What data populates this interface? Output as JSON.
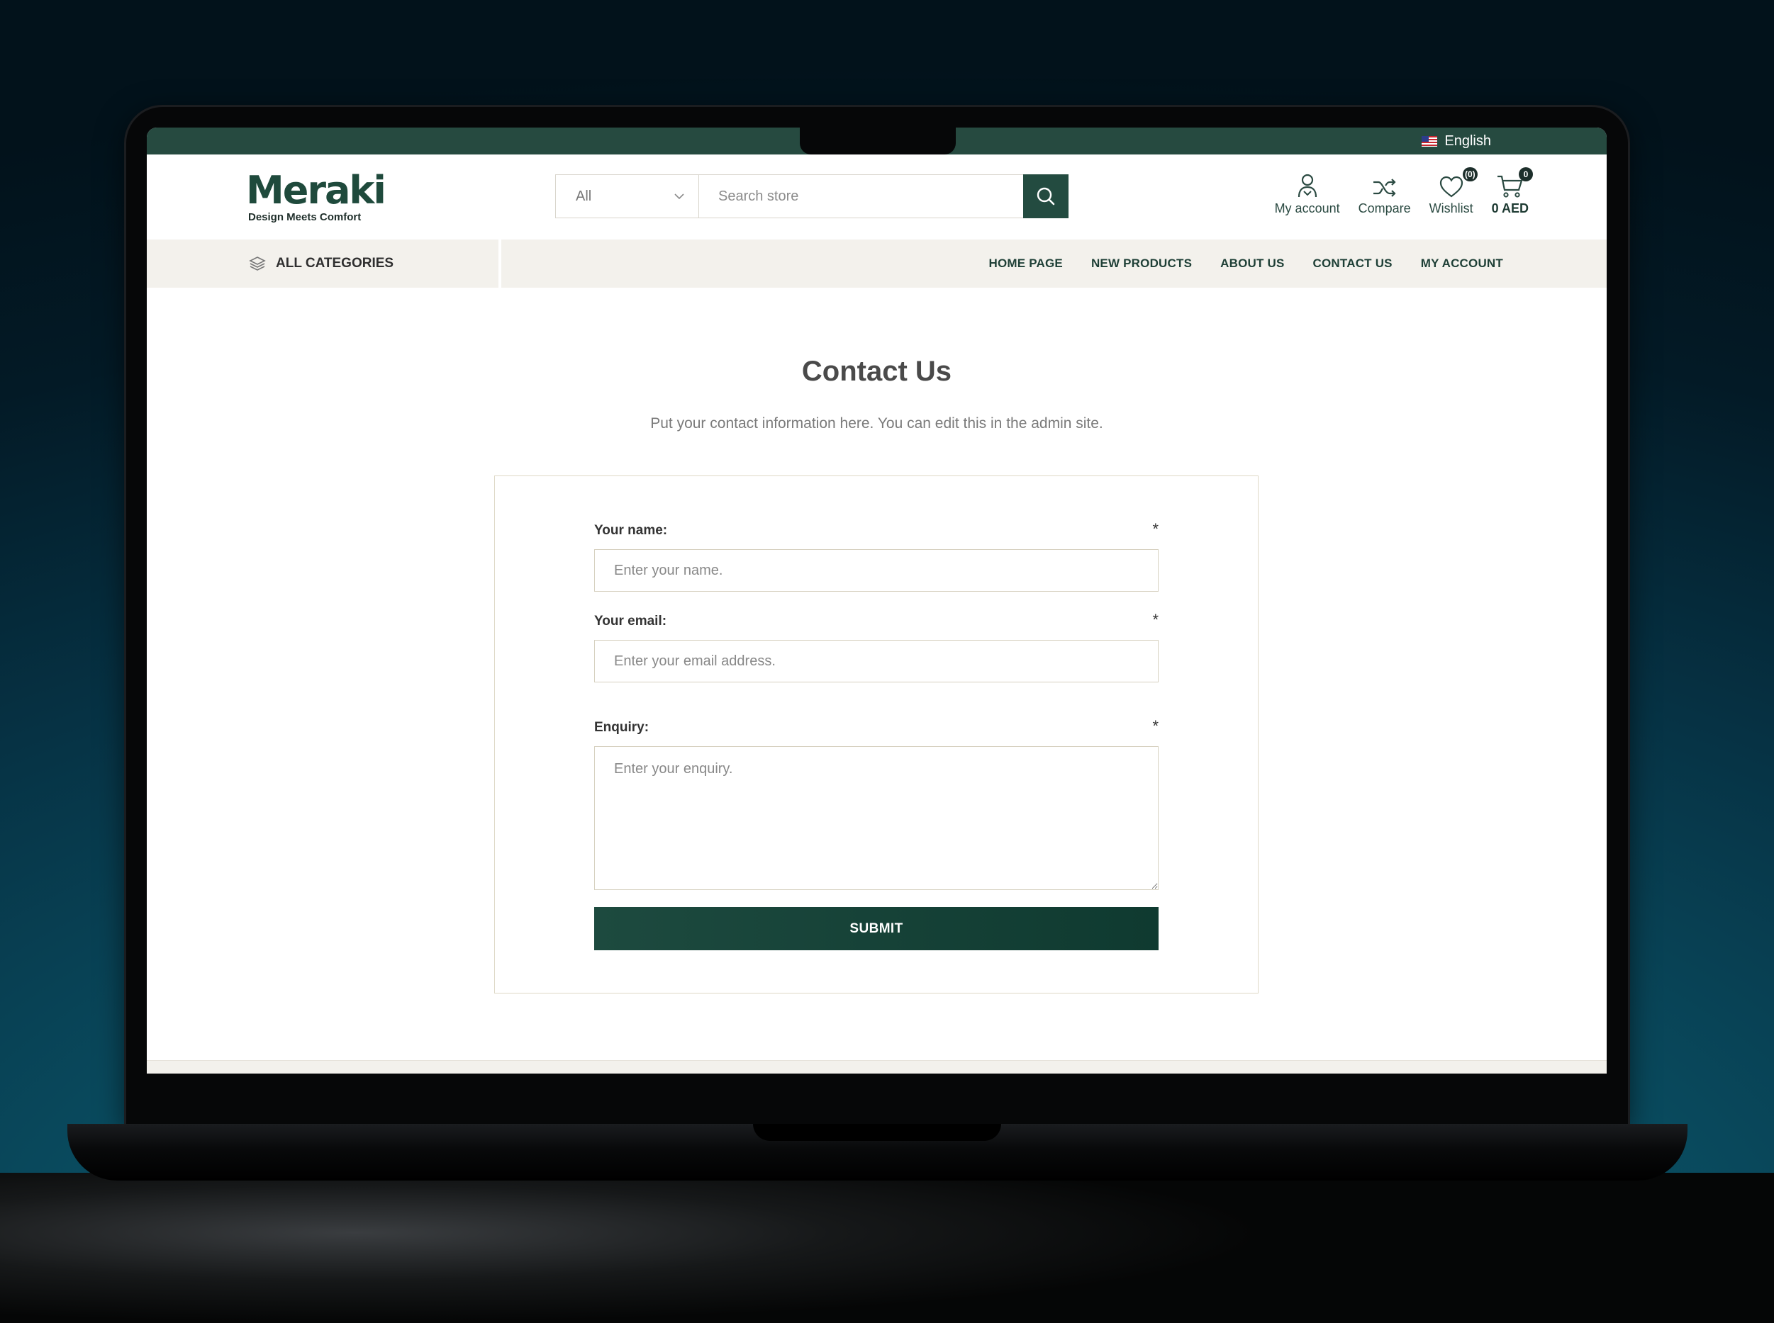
{
  "top_bar": {
    "language": "English"
  },
  "header": {
    "logo": {
      "word": "Meraki",
      "tagline": "Design Meets Comfort"
    },
    "search": {
      "category": "All",
      "placeholder": "Search store"
    },
    "actions": {
      "account_label": "My account",
      "compare_label": "Compare",
      "wishlist_label": "Wishlist",
      "wishlist_count": "(0)",
      "cart_count": "0",
      "cart_total": "0 AED"
    }
  },
  "navbar": {
    "all_categories": "ALL CATEGORIES",
    "links": [
      "HOME PAGE",
      "NEW PRODUCTS",
      "ABOUT US",
      "CONTACT US",
      "MY ACCOUNT"
    ]
  },
  "page": {
    "title": "Contact Us",
    "description": "Put your contact information here. You can edit this in the admin site."
  },
  "form": {
    "name_label": "Your name:",
    "name_placeholder": "Enter your name.",
    "email_label": "Your email:",
    "email_placeholder": "Enter your email address.",
    "enquiry_label": "Enquiry:",
    "enquiry_placeholder": "Enter your enquiry.",
    "required_mark": "*",
    "submit_label": "SUBMIT"
  },
  "colors": {
    "brand_green": "#234b40",
    "nav_background": "#f3f1ec",
    "form_border": "#ded8c6"
  },
  "icons": [
    "chevron-down-icon",
    "search-icon",
    "user-icon",
    "shuffle-icon",
    "heart-icon",
    "cart-icon",
    "layers-icon",
    "flag-icon"
  ]
}
